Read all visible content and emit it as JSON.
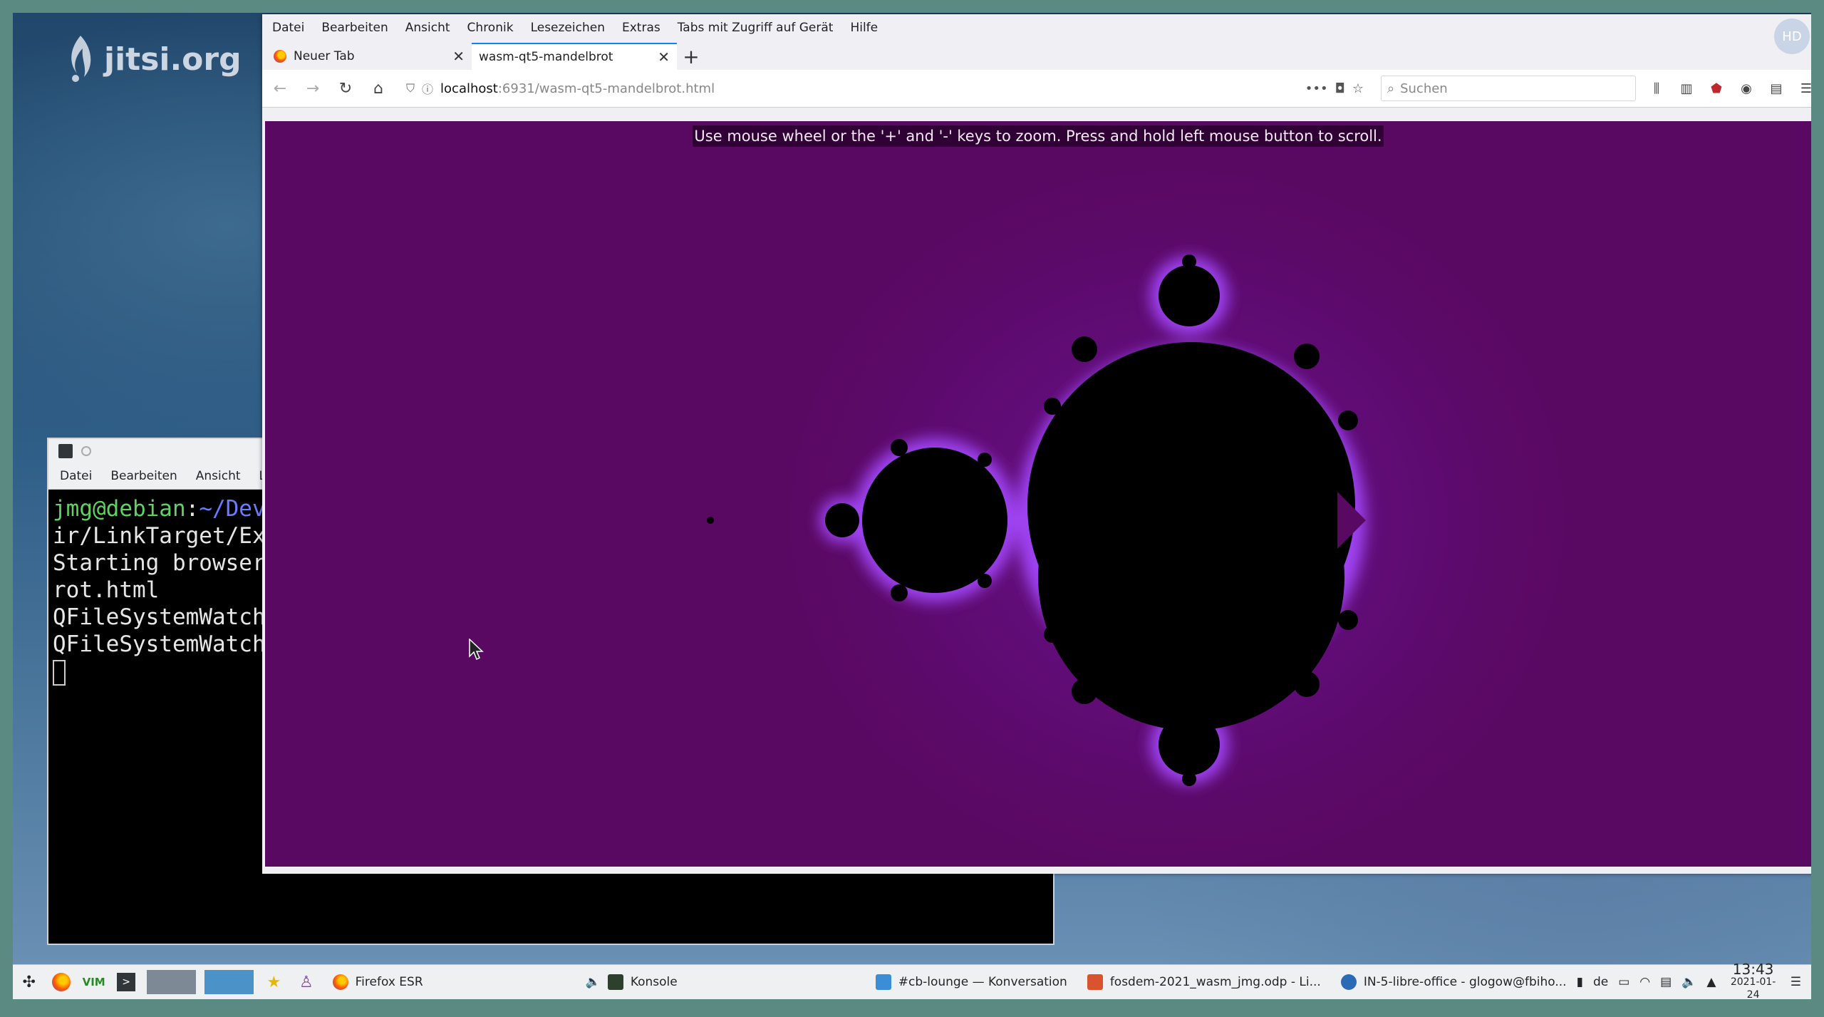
{
  "desktop": {
    "logo_text": "jitsi.org"
  },
  "konsole": {
    "menu": [
      "Datei",
      "Bearbeiten",
      "Ansicht",
      "Le"
    ],
    "prompt_user": "jmg@debian",
    "prompt_sep": ":",
    "prompt_path": "~/Dev",
    "lines": [
      "ir/LinkTarget/Ex",
      "Starting browser",
      "rot.html",
      "QFileSystemWatch",
      "QFileSystemWatch"
    ]
  },
  "firefox": {
    "menu": [
      "Datei",
      "Bearbeiten",
      "Ansicht",
      "Chronik",
      "Lesezeichen",
      "Extras",
      "Tabs mit Zugriff auf Gerät",
      "Hilfe"
    ],
    "avatar": "HD",
    "tabs": [
      {
        "title": "Neuer Tab"
      },
      {
        "title": "wasm-qt5-mandelbrot"
      }
    ],
    "url_host": "localhost",
    "url_rest": ":6931/wasm-qt5-mandelbrot.html",
    "search_placeholder": "Suchen",
    "hint": "Use mouse wheel or the '+' and '-' keys to zoom. Press and hold left mouse button to scroll."
  },
  "taskbar": {
    "tasks": [
      {
        "label": "Firefox ESR"
      },
      {
        "label": "Konsole"
      },
      {
        "label": "#cb-lounge — Konversation"
      },
      {
        "label": "fosdem-2021_wasm_jmg.odp - Li..."
      },
      {
        "label": "IN-5-libre-office - glogow@fbiho..."
      }
    ],
    "keyboard_layout": "de",
    "time": "13:43",
    "date": "2021-01-24"
  },
  "colors": {
    "fractal_background": "#5a0962",
    "fractal_glow": "#9a3cff",
    "fractal_set": "#000000"
  }
}
